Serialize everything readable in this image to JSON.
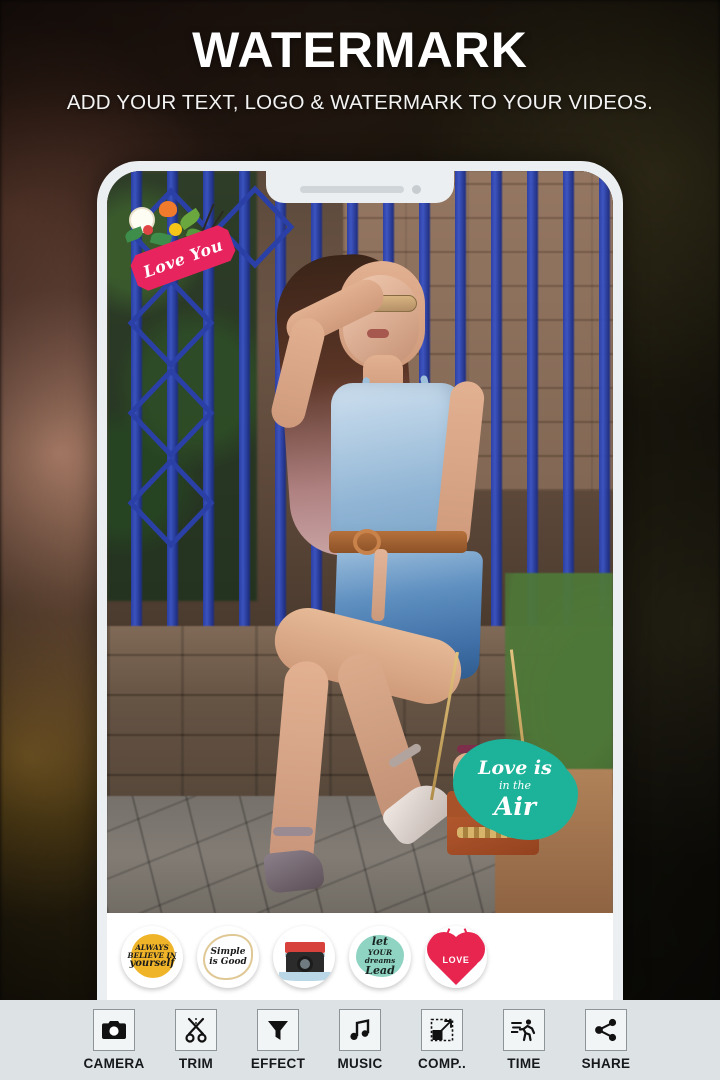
{
  "header": {
    "title": "WATERMARK",
    "subtitle": "ADD YOUR TEXT, LOGO & WATERMARK TO YOUR VIDEOS."
  },
  "colors": {
    "accent_pink": "#e8245f",
    "accent_green": "#1db39a",
    "toolbar_bg": "#dde2e5",
    "phone_frame": "#eceff1",
    "text_light": "#ffffff"
  },
  "phone": {
    "notch": {
      "speaker": "speaker-grill",
      "camera": "front-camera"
    }
  },
  "canvas": {
    "overlays": [
      {
        "id": "love-you",
        "type": "floral-banner-sticker",
        "text": "Love You",
        "banner_color": "#e8245f"
      },
      {
        "id": "love-is-in-the-air",
        "type": "blob-text-sticker",
        "line1": "Love is",
        "line2": "in the",
        "line3": "Air",
        "blob_color": "#1db39a"
      }
    ]
  },
  "sticker_tray": {
    "items": [
      {
        "id": "always-believe-in-yourself",
        "line1": "ALWAYS",
        "line2": "BELIEVE IN",
        "line3": "yourself",
        "color": "#f0b429"
      },
      {
        "id": "simple-is-good",
        "line1": "Simple",
        "line2": "is Good",
        "color": "#c79a3e"
      },
      {
        "id": "camera-vintage",
        "label": "camera-sticker",
        "color": "#d8423c"
      },
      {
        "id": "let-your-dreams-lead",
        "line1": "let",
        "line2": "YOUR",
        "line3": "dreams",
        "line4": "Lead",
        "color": "#8fd3c2"
      },
      {
        "id": "love-heart",
        "label": "LOVE",
        "color": "#e8254f"
      }
    ]
  },
  "toolbar": {
    "items": [
      {
        "label": "CAMERA",
        "icon": "camera-icon"
      },
      {
        "label": "TRIM",
        "icon": "scissors-icon"
      },
      {
        "label": "EFFECT",
        "icon": "funnel-icon"
      },
      {
        "label": "MUSIC",
        "icon": "music-note-icon"
      },
      {
        "label": "COMP..",
        "icon": "compress-icon"
      },
      {
        "label": "TIME",
        "icon": "running-man-icon"
      },
      {
        "label": "SHARE",
        "icon": "share-nodes-icon"
      }
    ]
  }
}
